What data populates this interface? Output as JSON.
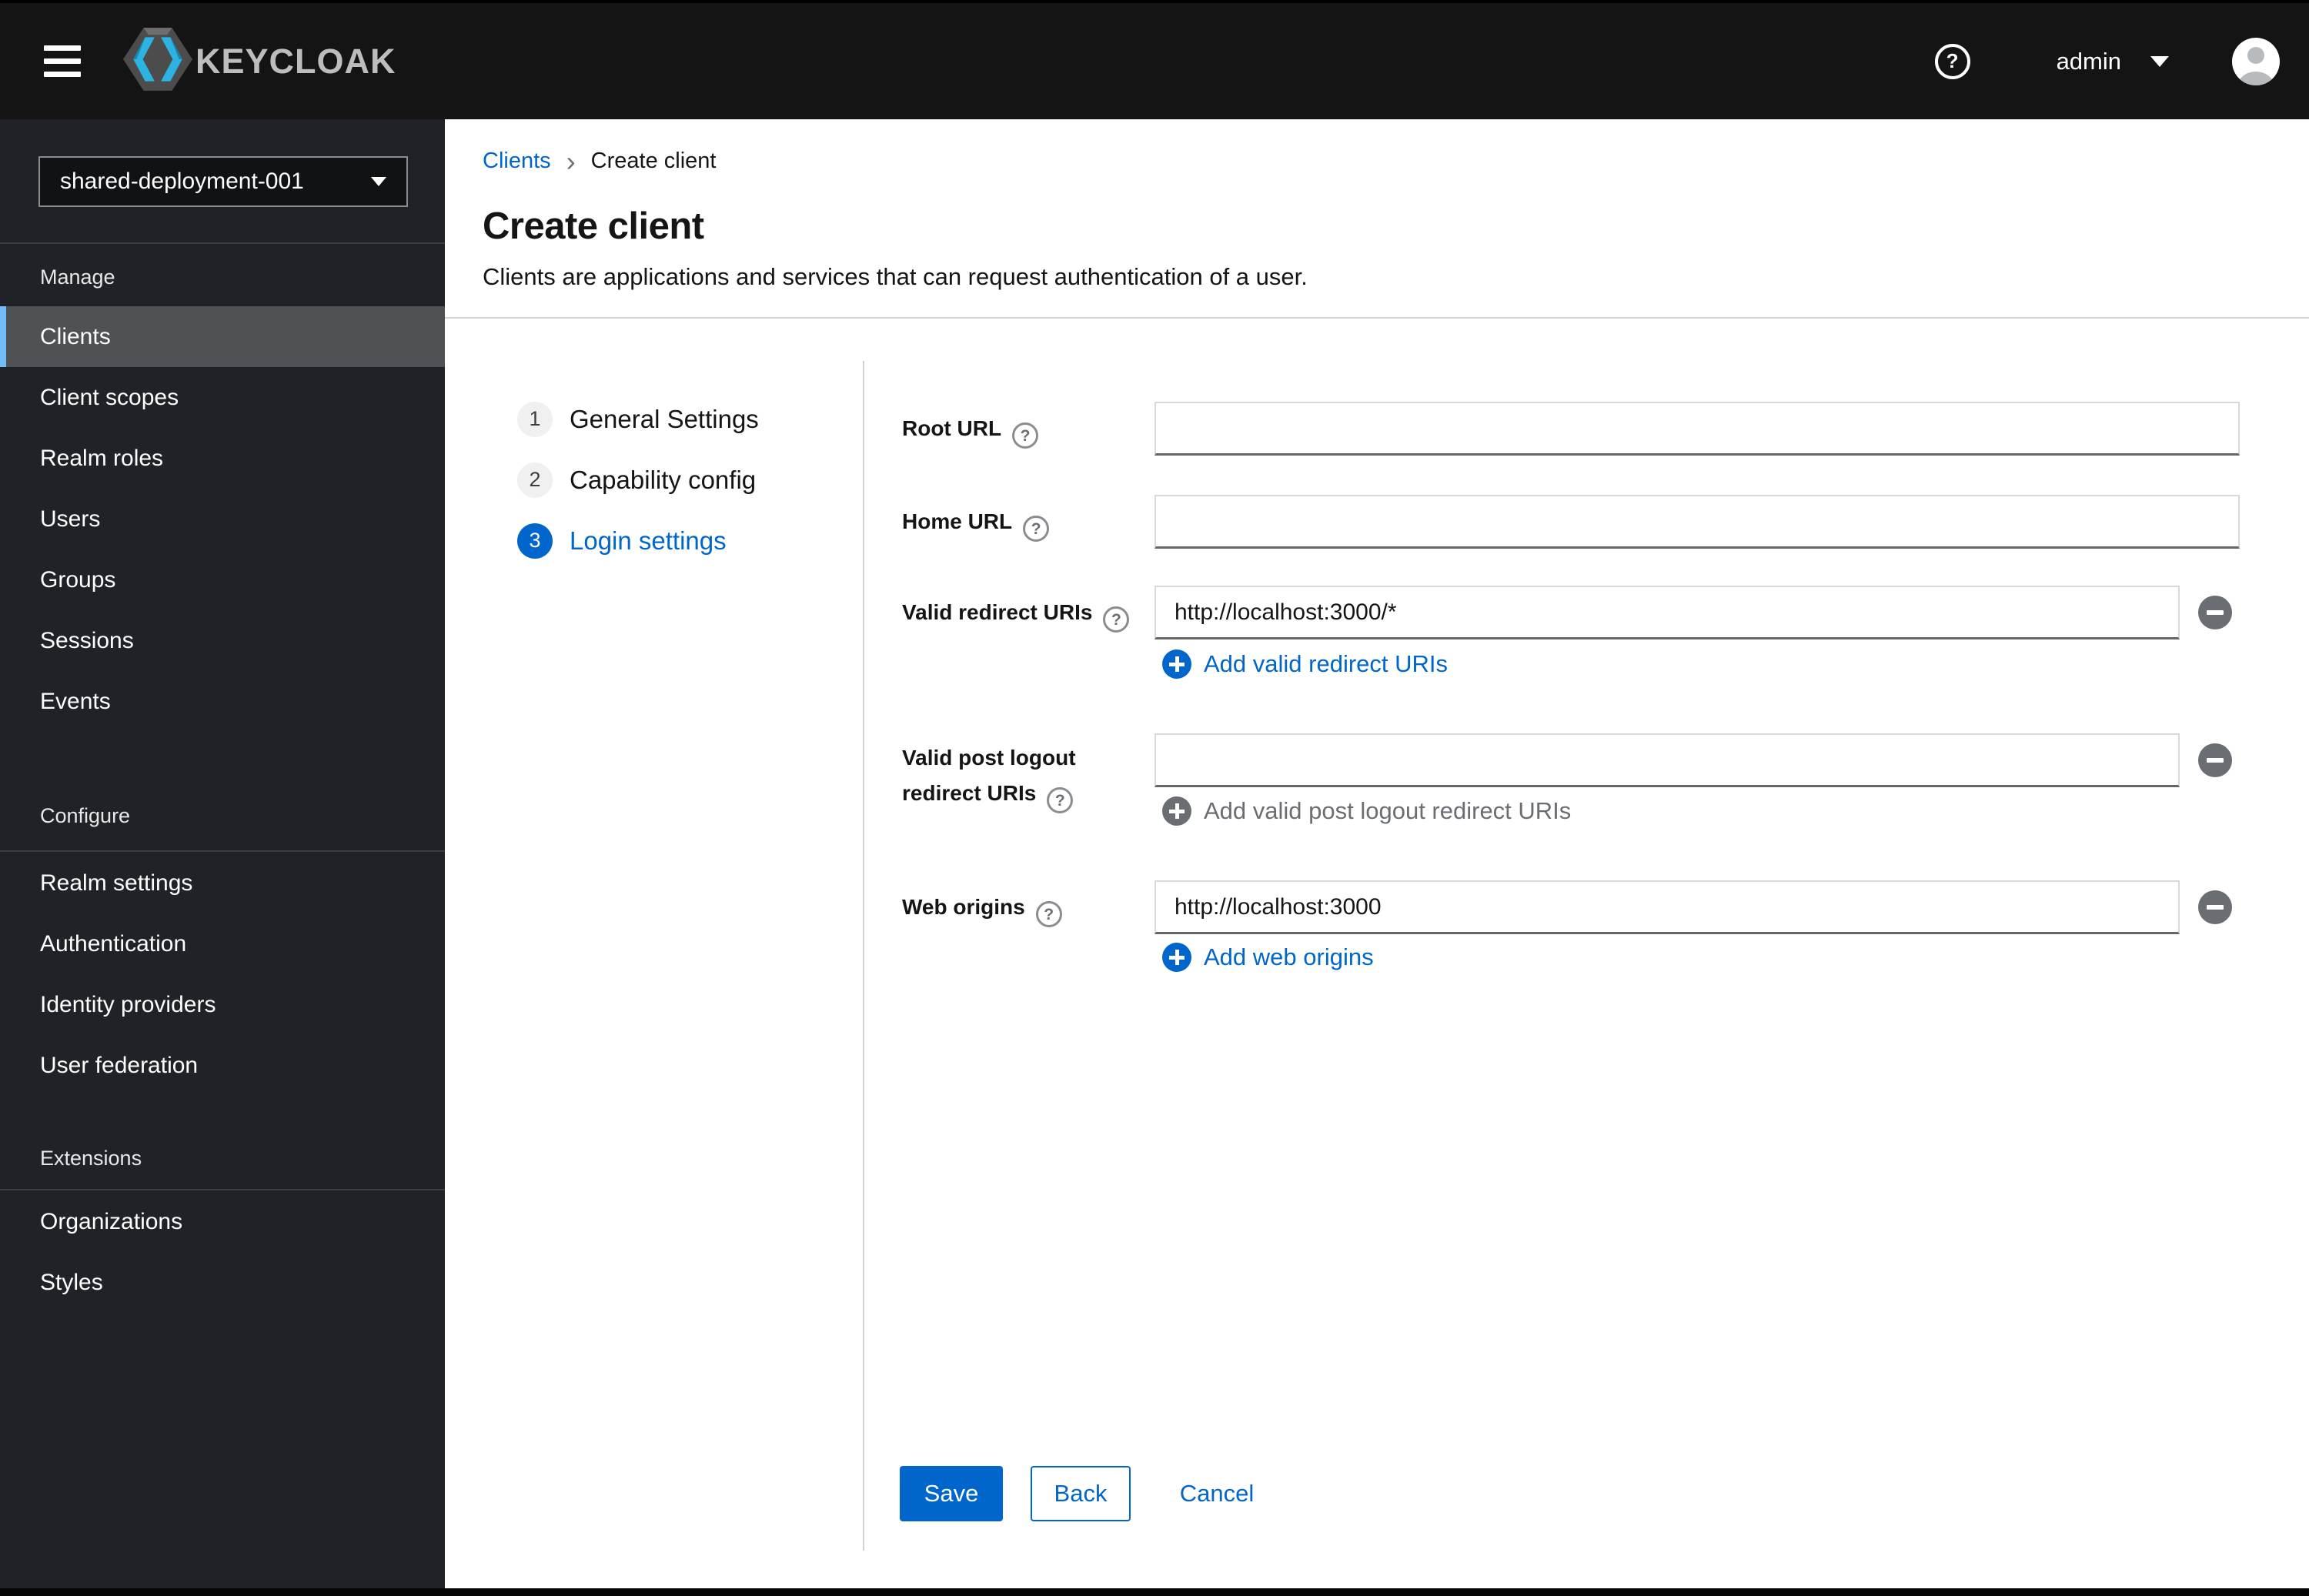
{
  "glyphs": {
    "question_mark": "?",
    "breadcrumb_chevron": "›"
  },
  "header": {
    "brand_text": "KEYCLOAK",
    "user": "admin"
  },
  "sidebar": {
    "realm_selector": {
      "value": "shared-deployment-001"
    },
    "groups": [
      {
        "label": "Manage",
        "items": [
          {
            "label": "Clients",
            "active": true
          },
          {
            "label": "Client scopes",
            "active": false
          },
          {
            "label": "Realm roles",
            "active": false
          },
          {
            "label": "Users",
            "active": false
          },
          {
            "label": "Groups",
            "active": false
          },
          {
            "label": "Sessions",
            "active": false
          },
          {
            "label": "Events",
            "active": false
          }
        ]
      },
      {
        "label": "Configure",
        "items": [
          {
            "label": "Realm settings",
            "active": false
          },
          {
            "label": "Authentication",
            "active": false
          },
          {
            "label": "Identity providers",
            "active": false
          },
          {
            "label": "User federation",
            "active": false
          }
        ]
      },
      {
        "label": "Extensions",
        "items": [
          {
            "label": "Organizations",
            "active": false
          },
          {
            "label": "Styles",
            "active": false
          }
        ]
      }
    ]
  },
  "breadcrumb": {
    "link": "Clients",
    "current": "Create client"
  },
  "page": {
    "title": "Create client",
    "subtitle": "Clients are applications and services that can request authentication of a user."
  },
  "wizard": {
    "steps": [
      {
        "number": "1",
        "label": "General Settings",
        "state": "default"
      },
      {
        "number": "2",
        "label": "Capability config",
        "state": "default"
      },
      {
        "number": "3",
        "label": "Login settings",
        "state": "current"
      }
    ]
  },
  "form": {
    "root_url": {
      "label": "Root URL",
      "value": ""
    },
    "home_url": {
      "label": "Home URL",
      "value": ""
    },
    "valid_redirect_uris": {
      "label": "Valid redirect URIs",
      "value": "http://localhost:3000/*",
      "add_label": "Add valid redirect URIs",
      "add_enabled": true
    },
    "post_logout_redirect_uris": {
      "label": "Valid post logout redirect URIs",
      "value": "",
      "add_label": "Add valid post logout redirect URIs",
      "add_enabled": false
    },
    "web_origins": {
      "label": "Web origins",
      "value": "http://localhost:3000",
      "add_label": "Add web origins",
      "add_enabled": true
    }
  },
  "actions": {
    "save": "Save",
    "back": "Back",
    "cancel": "Cancel"
  },
  "colors": {
    "accent": "#0066cc",
    "active_indicator": "#73bcf7",
    "link_disabled": "#6a6e73",
    "header_bg": "#141414",
    "sidebar_bg": "#1f2226"
  }
}
